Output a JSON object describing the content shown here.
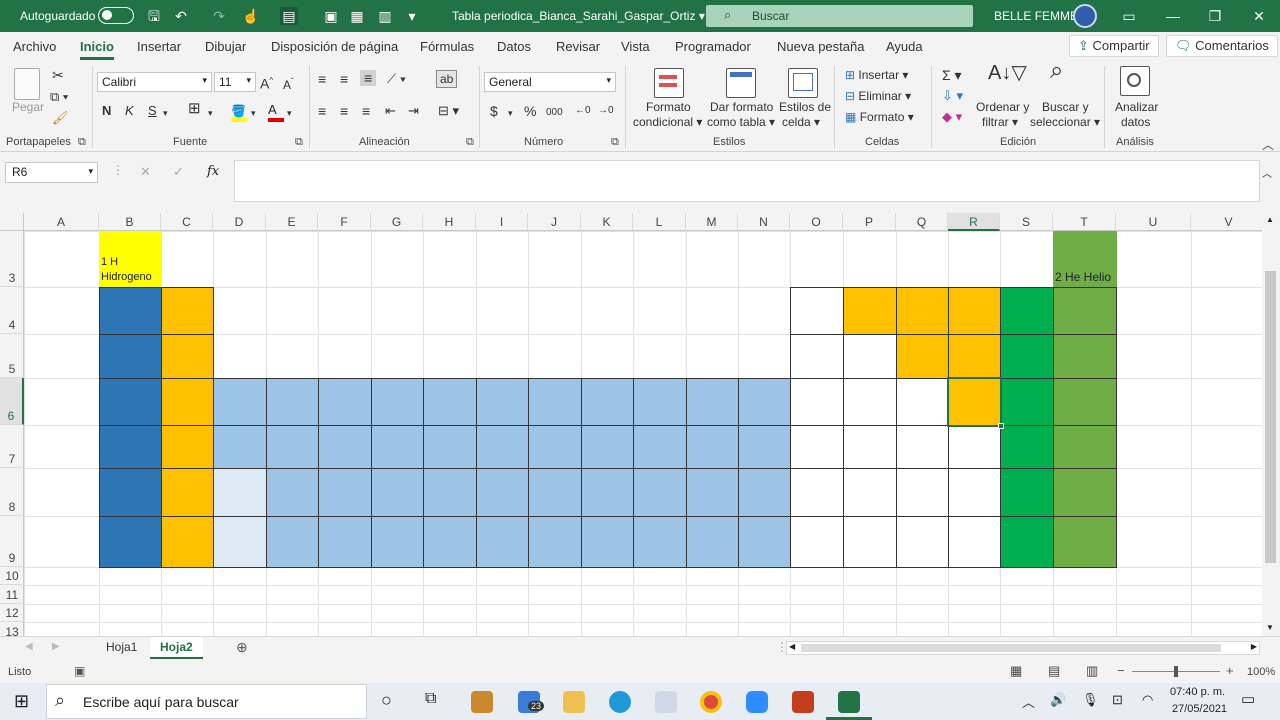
{
  "titlebar": {
    "autosave_label": "Autoguardado",
    "doc_title": "Tabla periodica_Bianca_Sarahi_Gaspar_Ortiz",
    "search_placeholder": "Buscar",
    "user_name": "BELLE FEMME"
  },
  "menu": {
    "tabs": [
      "Archivo",
      "Inicio",
      "Insertar",
      "Dibujar",
      "Disposición de página",
      "Fórmulas",
      "Datos",
      "Revisar",
      "Vista",
      "Programador",
      "Nueva pestaña",
      "Ayuda"
    ],
    "active": "Inicio",
    "share_label": "Compartir",
    "comments_label": "Comentarios"
  },
  "ribbon": {
    "clipboard": {
      "paste_label": "Pegar",
      "group_label": "Portapapeles"
    },
    "font": {
      "font_name": "Calibri",
      "font_size": "11",
      "group_label": "Fuente",
      "bold": "N",
      "italic": "K",
      "underline": "S"
    },
    "alignment": {
      "group_label": "Alineación"
    },
    "number": {
      "format": "General",
      "group_label": "Número"
    },
    "styles": {
      "conditional": [
        "Formato",
        "condicional"
      ],
      "as_table": [
        "Dar formato",
        "como tabla"
      ],
      "cell_styles": [
        "Estilos de",
        "celda"
      ],
      "group_label": "Estilos"
    },
    "cells": {
      "insert": "Insertar",
      "delete": "Eliminar",
      "format": "Formato",
      "group_label": "Celdas"
    },
    "editing": {
      "sort": [
        "Ordenar y",
        "filtrar"
      ],
      "find": [
        "Buscar y",
        "seleccionar"
      ],
      "group_label": "Edición"
    },
    "analysis": {
      "analyze": [
        "Analizar",
        "datos"
      ],
      "group_label": "Análisis"
    }
  },
  "formula_bar": {
    "name_box": "R6",
    "fx_label": "fx",
    "formula": ""
  },
  "grid": {
    "columns": [
      "A",
      "B",
      "C",
      "D",
      "E",
      "F",
      "G",
      "H",
      "I",
      "J",
      "K",
      "L",
      "M",
      "N",
      "O",
      "P",
      "Q",
      "R",
      "S",
      "T",
      "U",
      "V"
    ],
    "rows": [
      "3",
      "4",
      "5",
      "6",
      "7",
      "8",
      "9",
      "10",
      "11",
      "12",
      "13"
    ],
    "selected_cell": "R6",
    "cells": {
      "B3": [
        "1 H",
        "Hidrogeno"
      ],
      "T3": "2 He Helio"
    },
    "colors": {
      "alkali_blue": "#2e75b6",
      "alkaline_orange": "#ffc000",
      "transition_lightblue": "#9dc3e6",
      "pale_blue": "#deebf7",
      "hydrogen_yellow": "#ffff00",
      "halogen_green": "#00b050",
      "noble_green": "#70ad47"
    }
  },
  "sheets": {
    "tabs": [
      "Hoja1",
      "Hoja2"
    ],
    "active": "Hoja2"
  },
  "status": {
    "ready": "Listo",
    "zoom": "100%"
  },
  "taskbar": {
    "search_placeholder": "Escribe aquí para buscar",
    "mail_badge": "23",
    "time": "07:40 p. m.",
    "date": "27/05/2021"
  }
}
